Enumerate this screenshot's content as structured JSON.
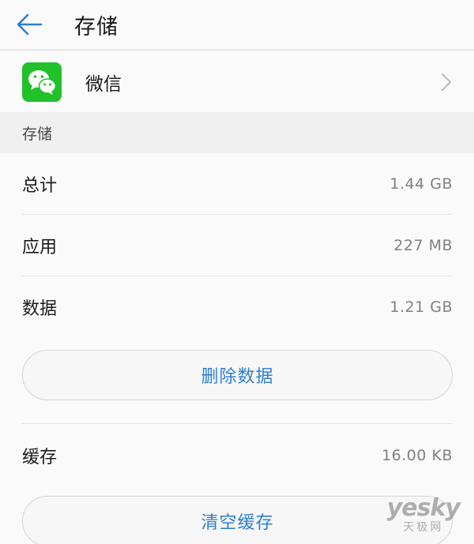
{
  "header": {
    "title": "存储",
    "back_icon": "arrow-left-icon",
    "accent_color": "#2d7fd0"
  },
  "app": {
    "name": "微信",
    "icon": "wechat-icon",
    "icon_color": "#21c12a",
    "chevron_icon": "chevron-right-icon"
  },
  "section": {
    "title": "存储"
  },
  "storage": {
    "total_label": "总计",
    "total_value": "1.44 GB",
    "app_label": "应用",
    "app_value": "227 MB",
    "data_label": "数据",
    "data_value": "1.21 GB",
    "delete_data_label": "删除数据",
    "cache_label": "缓存",
    "cache_value": "16.00 KB",
    "clear_cache_label": "清空缓存"
  },
  "watermark": {
    "main": "yesky",
    "sub": "天极网"
  }
}
